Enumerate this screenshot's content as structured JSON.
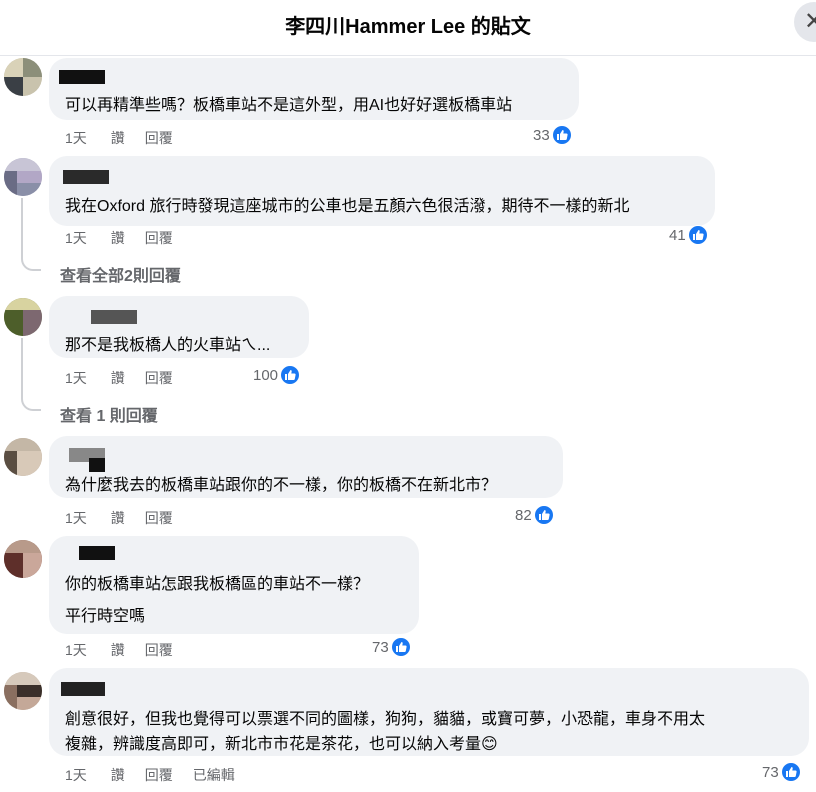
{
  "header": {
    "title": "李四川Hammer Lee 的貼文",
    "close_icon": "close-icon"
  },
  "labels": {
    "time": "1天",
    "like": "讚",
    "reply": "回覆",
    "edited": "已編輯"
  },
  "comments": [
    {
      "text": "可以再精準些嗎？板橋車站不是這外型，用AI也好好選板橋車站",
      "likes": "33"
    },
    {
      "text": "我在Oxford 旅行時發現這座城市的公車也是五顏六色很活潑，期待不一樣的新北",
      "likes": "41",
      "view_replies": "查看全部2則回覆"
    },
    {
      "text": "那不是我板橋人的火車站ㄟ...",
      "likes": "100",
      "view_replies": "查看 1 則回覆"
    },
    {
      "text": "為什麼我去的板橋車站跟你的不一樣，你的板橋不在新北市？",
      "likes": "82"
    },
    {
      "text_line1": "你的板橋車站怎跟我板橋區的車站不一樣？",
      "text_line2": "平行時空嗎",
      "likes": "73"
    },
    {
      "text_line1": "創意很好，但我也覺得可以票選不同的圖樣，狗狗，貓貓，或寶可夢，小恐龍，車身不用太",
      "text_line2": "複雜，辨識度高即可，新北市市花是茶花，也可以納入考量😊",
      "likes": "73"
    }
  ],
  "colors": {
    "bubble": "#f0f2f5",
    "meta_text": "#65676b",
    "like_blue": "#1877f2"
  }
}
